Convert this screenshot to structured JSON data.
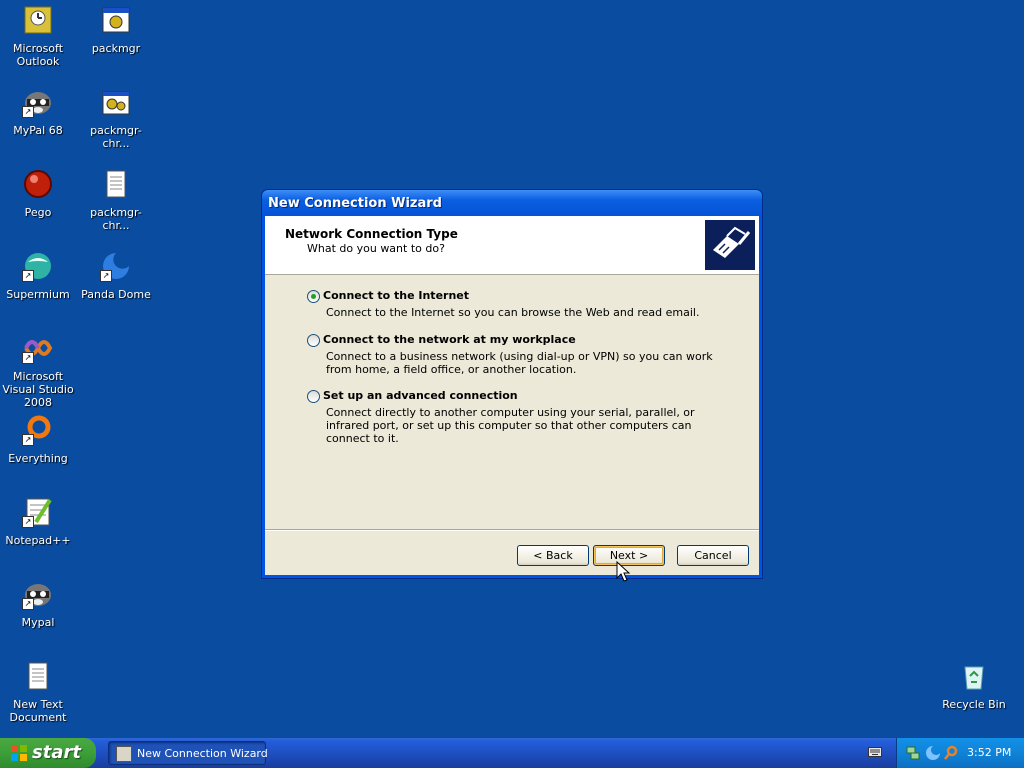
{
  "desktop": {
    "background_color": "#0a4ca0",
    "icons": [
      {
        "label": "Microsoft Outlook",
        "icon": "outlook-icon",
        "shortcut": false
      },
      {
        "label": "packmgr",
        "icon": "app-window-icon",
        "shortcut": false
      },
      {
        "label": "MyPal 68",
        "icon": "raccoon-icon",
        "shortcut": true
      },
      {
        "label": "packmgr-chr...",
        "icon": "batch-file-icon",
        "shortcut": false
      },
      {
        "label": "Pego",
        "icon": "red-orb-icon",
        "shortcut": false
      },
      {
        "label": "packmgr-chr...",
        "icon": "text-file-icon",
        "shortcut": false
      },
      {
        "label": "Supermium",
        "icon": "supermium-icon",
        "shortcut": true
      },
      {
        "label": "Panda Dome",
        "icon": "panda-dome-icon",
        "shortcut": true
      },
      {
        "label": "Microsoft Visual Studio 2008",
        "icon": "visual-studio-icon",
        "shortcut": true
      },
      {
        "label": "Everything",
        "icon": "everything-search-icon",
        "shortcut": true
      },
      {
        "label": "Notepad++",
        "icon": "notepad-plus-plus-icon",
        "shortcut": true
      },
      {
        "label": "Mypal",
        "icon": "raccoon-icon",
        "shortcut": true
      },
      {
        "label": "New Text Document",
        "icon": "text-file-icon",
        "shortcut": false
      },
      {
        "label": "Recycle Bin",
        "icon": "recycle-bin-icon",
        "shortcut": false
      }
    ]
  },
  "wizard": {
    "title": "New Connection Wizard",
    "header_title": "Network Connection Type",
    "header_subtitle": "What do you want to do?",
    "header_icon": "network-cable-icon",
    "options": [
      {
        "label": "Connect to the Internet",
        "description": "Connect to the Internet so you can browse the Web and read email.",
        "checked": true
      },
      {
        "label": "Connect to the network at my workplace",
        "description": "Connect to a business network (using dial-up or VPN) so you can work from home, a field office, or another location.",
        "checked": false
      },
      {
        "label": "Set up an advanced connection",
        "description": "Connect directly to another computer using your serial, parallel, or infrared port, or set up this computer so that other computers can connect to it.",
        "checked": false
      }
    ],
    "buttons": {
      "back": "< Back",
      "next": "Next >",
      "cancel": "Cancel"
    }
  },
  "taskbar": {
    "start_label": "start",
    "task_button_label": "New Connection Wizard",
    "clock": "3:52 PM",
    "tray_icons": [
      "network-tray-icon",
      "panda-tray-icon",
      "search-tray-icon"
    ]
  }
}
